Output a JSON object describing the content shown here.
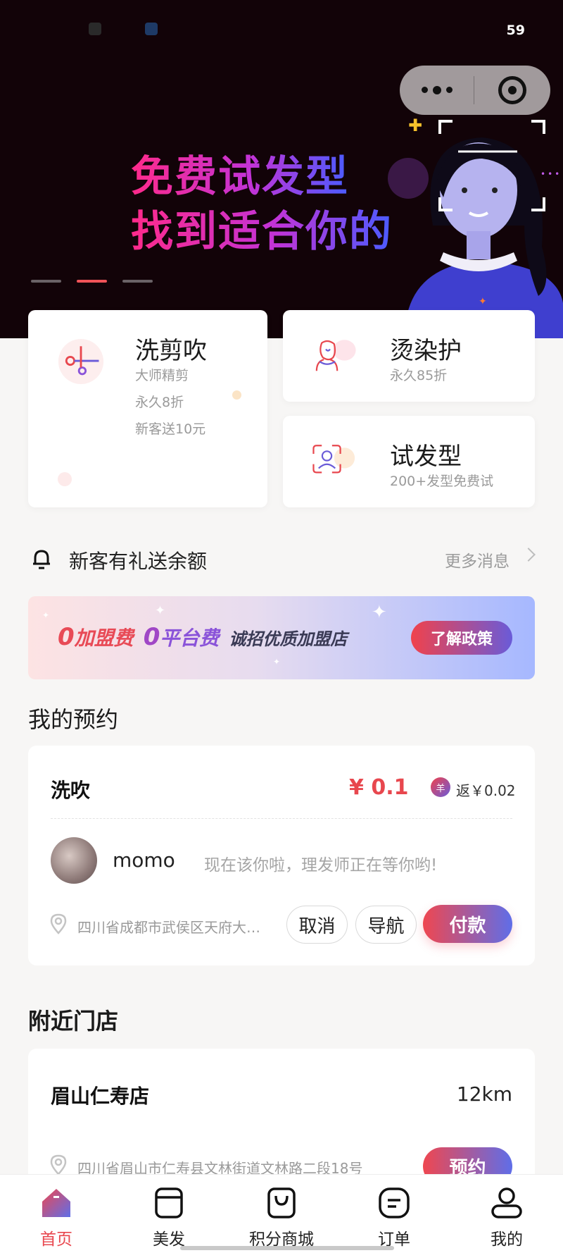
{
  "status_bar": {
    "time": "59"
  },
  "hero": {
    "line1": "免费试发型",
    "line2": "找到适合你的"
  },
  "services": {
    "wash": {
      "title": "洗剪吹",
      "lines": [
        "大师精剪",
        "永久8折",
        "新客送10元"
      ]
    },
    "perm": {
      "title": "烫染护",
      "sub": "永久85折"
    },
    "trial": {
      "title": "试发型",
      "sub": "200+发型免费试"
    }
  },
  "notice": {
    "text": "新客有礼送余额",
    "more": "更多消息"
  },
  "banner": {
    "zero1": "0",
    "fee1": "加盟费",
    "zero2": "0",
    "fee2": "平台费",
    "recruit": "诚招优质加盟店",
    "button": "了解政策"
  },
  "appointment_section": {
    "title": "我的预约"
  },
  "appointment": {
    "service": "洗吹",
    "price": "¥ 0.1",
    "rebate_icon": "羊",
    "rebate": "返￥0.02",
    "user": "momo",
    "message": "现在该你啦，理发师正在等你哟!",
    "address": "四川省成都市武侯区天府大…",
    "cancel": "取消",
    "navigate": "导航",
    "pay": "付款"
  },
  "nearby_section": {
    "title": "附近门店"
  },
  "store": {
    "name": "眉山仁寿店",
    "distance": "12km",
    "address": "四川省眉山市仁寿县文林街道文林路二段18号",
    "book": "预约"
  },
  "tabs": [
    {
      "label": "首页",
      "icon": "home-icon",
      "active": true
    },
    {
      "label": "美发",
      "icon": "box-icon"
    },
    {
      "label": "积分商城",
      "icon": "shopping-bag-icon"
    },
    {
      "label": "订单",
      "icon": "order-icon"
    },
    {
      "label": "我的",
      "icon": "profile-icon"
    }
  ],
  "colors": {
    "accent": "#e8474e",
    "gradient_start": "#ef4750",
    "gradient_end": "#5f6ee8"
  }
}
